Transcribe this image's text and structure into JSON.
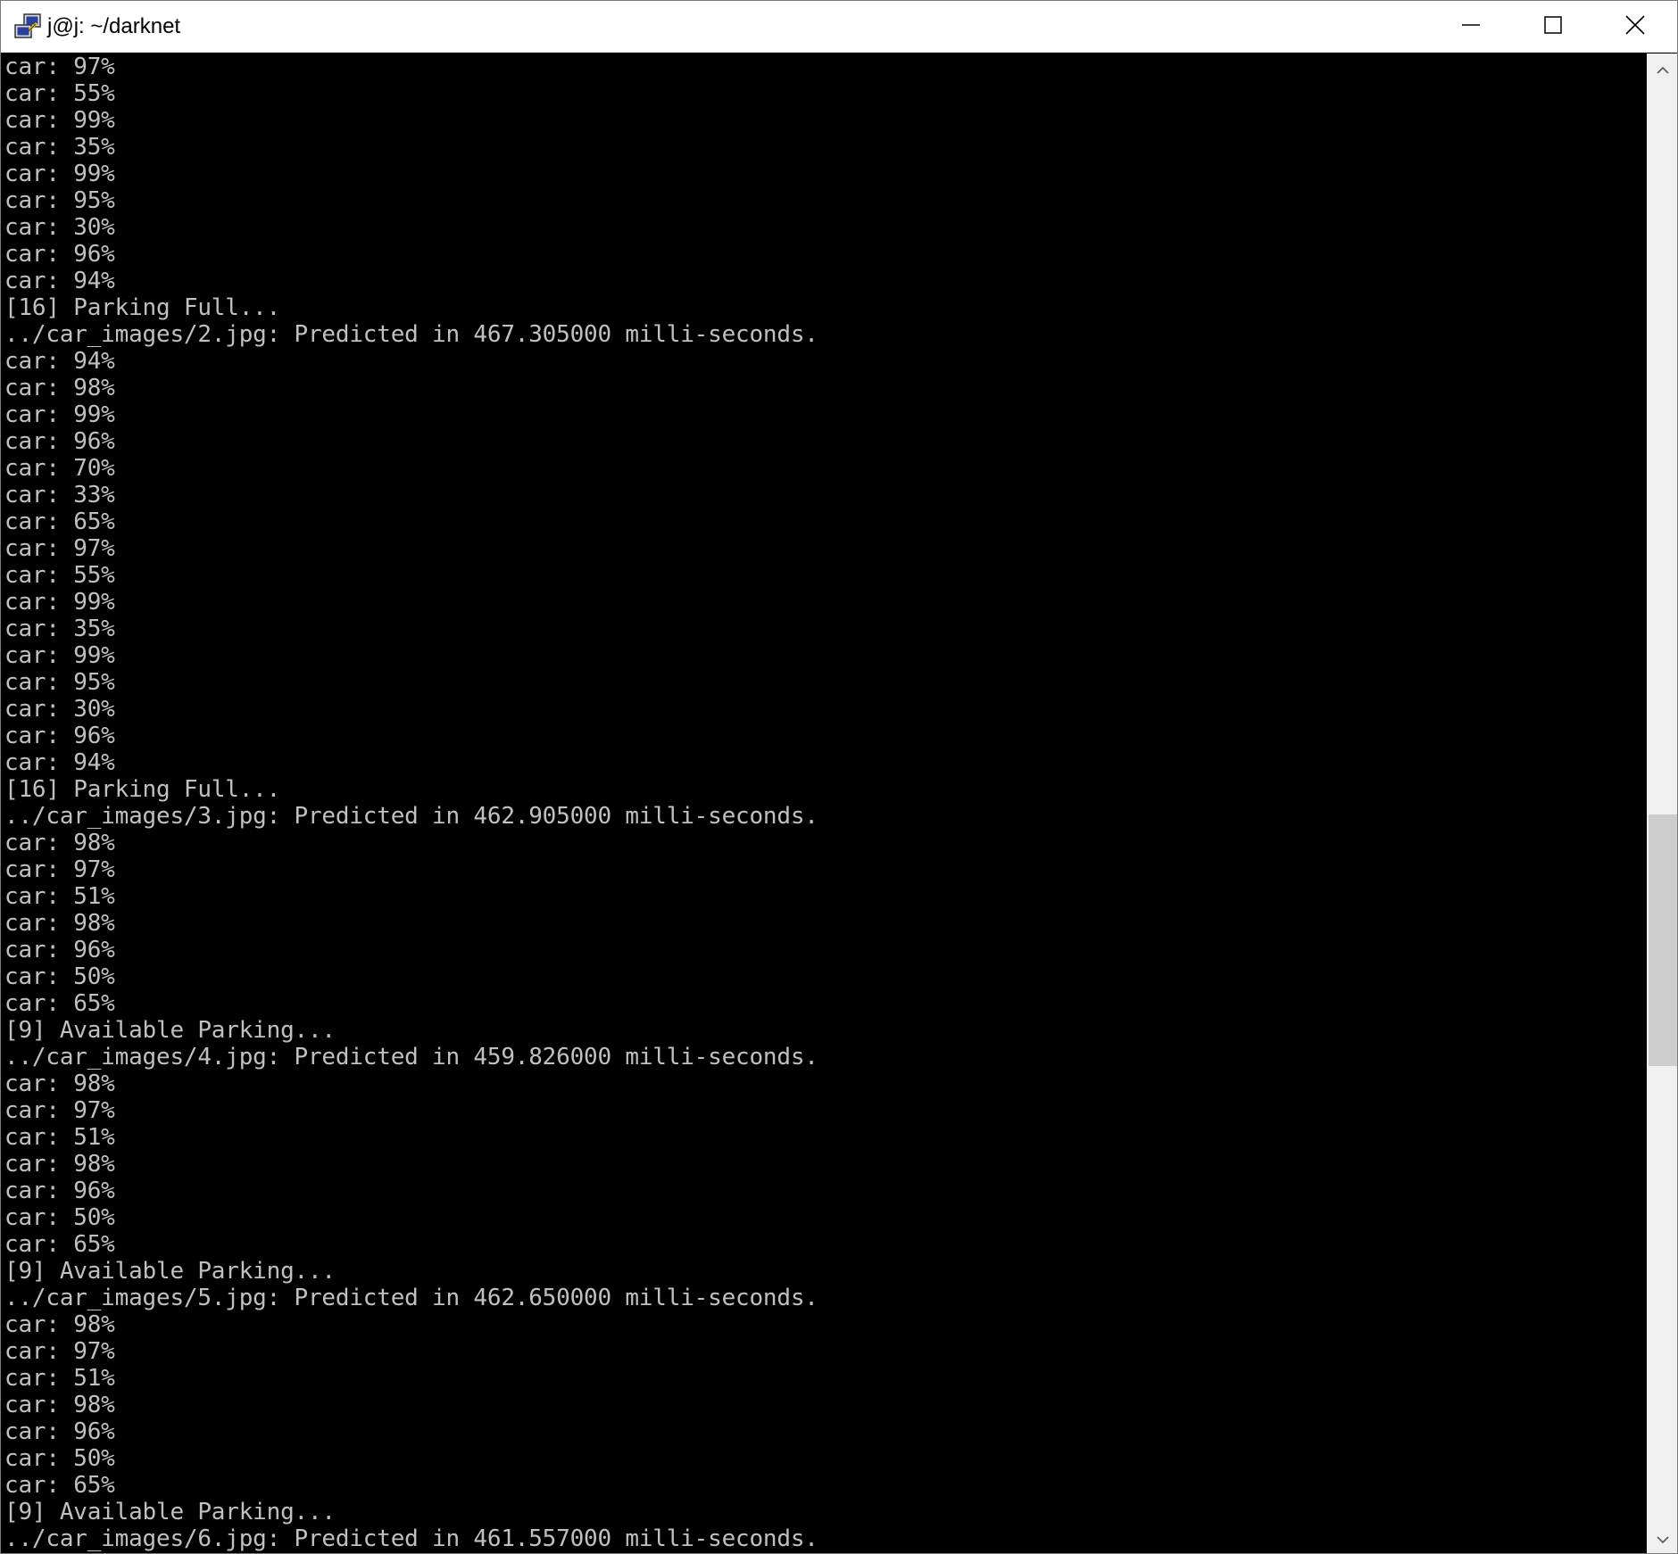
{
  "window": {
    "title": "j@j: ~/darknet",
    "icon": "putty-icon",
    "buttons": {
      "minimize": "minimize-icon",
      "maximize": "maximize-icon",
      "close": "close-icon"
    }
  },
  "colors": {
    "terminal_bg": "#000000",
    "terminal_fg": "#c0c0c0",
    "titlebar_bg": "#ffffff",
    "scrollbar_track": "#f0f0f0",
    "scrollbar_thumb": "#cdcdcd"
  },
  "terminal": {
    "lines": [
      "car: 97%",
      "car: 55%",
      "car: 99%",
      "car: 35%",
      "car: 99%",
      "car: 95%",
      "car: 30%",
      "car: 96%",
      "car: 94%",
      "[16] Parking Full...",
      "../car_images/2.jpg: Predicted in 467.305000 milli-seconds.",
      "car: 94%",
      "car: 98%",
      "car: 99%",
      "car: 96%",
      "car: 70%",
      "car: 33%",
      "car: 65%",
      "car: 97%",
      "car: 55%",
      "car: 99%",
      "car: 35%",
      "car: 99%",
      "car: 95%",
      "car: 30%",
      "car: 96%",
      "car: 94%",
      "[16] Parking Full...",
      "../car_images/3.jpg: Predicted in 462.905000 milli-seconds.",
      "car: 98%",
      "car: 97%",
      "car: 51%",
      "car: 98%",
      "car: 96%",
      "car: 50%",
      "car: 65%",
      "[9] Available Parking...",
      "../car_images/4.jpg: Predicted in 459.826000 milli-seconds.",
      "car: 98%",
      "car: 97%",
      "car: 51%",
      "car: 98%",
      "car: 96%",
      "car: 50%",
      "car: 65%",
      "[9] Available Parking...",
      "../car_images/5.jpg: Predicted in 462.650000 milli-seconds.",
      "car: 98%",
      "car: 97%",
      "car: 51%",
      "car: 98%",
      "car: 96%",
      "car: 50%",
      "car: 65%",
      "[9] Available Parking...",
      "../car_images/6.jpg: Predicted in 461.557000 milli-seconds."
    ]
  },
  "scrollbar": {
    "up_icon": "chevron-up-icon",
    "down_icon": "chevron-down-icon"
  }
}
